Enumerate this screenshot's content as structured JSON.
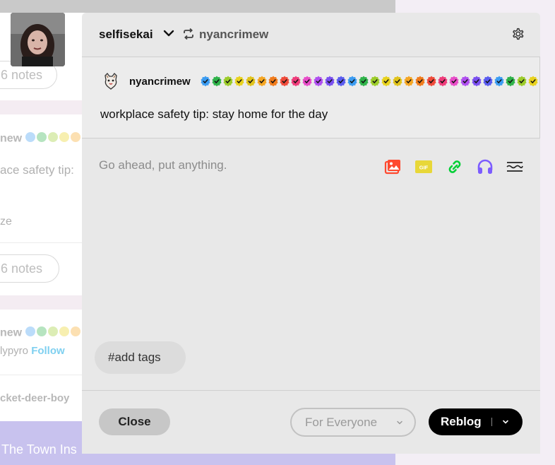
{
  "background": {
    "notes_top": "6 notes",
    "blog_partial_1": "new",
    "text_partial": "ace safety tip:",
    "tag_partial": "ze",
    "notes_mid": "6 notes",
    "blog_partial_2": "new",
    "user_partial": "lypyro",
    "follow_label": "Follow",
    "user_partial_2": "cket-deer-boy",
    "banner_partial": "The Town Ins"
  },
  "header": {
    "blog_name": "selfisekai",
    "source_blog": "nyancrimew",
    "icons": {
      "chevron": "chevron-down-icon",
      "reblog": "reblog-icon",
      "settings": "gear-icon"
    }
  },
  "post": {
    "author": "nyancrimew",
    "text": "workplace safety tip: stay home for the day",
    "badge_colors": [
      "#3b9cf2",
      "#2fb34a",
      "#9ccc2a",
      "#e8d21d",
      "#e0c31b",
      "#f5a623",
      "#f07b1b",
      "#ef4a3a",
      "#ef3b7a",
      "#e84cc8",
      "#b04ff0",
      "#7a4ff0",
      "#5a5cf0",
      "#3b9cf2",
      "#2fb34a",
      "#9ccc2a",
      "#e8d21d",
      "#e0c31b",
      "#f5a623",
      "#f07b1b",
      "#ef4a3a",
      "#ef3b7a",
      "#e84cc8",
      "#b04ff0",
      "#7a4ff0",
      "#5a5cf0",
      "#3b9cf2",
      "#2fb34a",
      "#9ccc2a",
      "#e8d21d"
    ]
  },
  "editor": {
    "placeholder": "Go ahead, put anything.",
    "toolbar": [
      {
        "name": "photo-icon",
        "color": "#ff492f"
      },
      {
        "name": "gif-icon",
        "color": "#e8d738",
        "label": "GIF"
      },
      {
        "name": "link-icon",
        "color": "#00cf35"
      },
      {
        "name": "audio-icon",
        "color": "#7c5cff"
      },
      {
        "name": "readmore-icon",
        "color": "#222222"
      }
    ]
  },
  "tags": {
    "placeholder": "#add tags"
  },
  "footer": {
    "close_label": "Close",
    "audience_label": "For Everyone",
    "reblog_label": "Reblog"
  }
}
